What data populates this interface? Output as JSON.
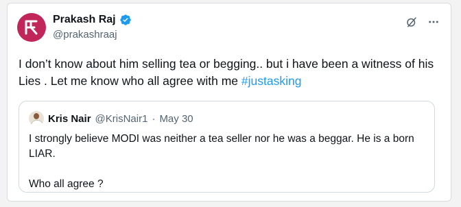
{
  "tweet": {
    "display_name": "Prakash Raj",
    "handle": "@prakashraaj",
    "text_main": "I don’t know about him selling tea or begging.. but i have been a witness of his Lies . Let me know who all agree with me ",
    "hashtag": "#justasking",
    "avatar_icon": "prakash-raj-logo-icon",
    "verified_icon": "verified-badge-icon",
    "grok_icon": "grok-icon",
    "more_icon": "more-options-icon"
  },
  "quote": {
    "display_name": "Kris Nair",
    "handle": "@KrisNair1",
    "separator": "·",
    "date": "May 30",
    "text_line1": "I strongly believe MODI was neither a tea seller nor he was a beggar. He is a born LIAR.",
    "text_line2": "Who all agree ?"
  },
  "colors": {
    "link": "#1d9bf0",
    "verified": "#1d9bf0",
    "avatar_bg": "#c0265a",
    "secondary_text": "#536471"
  }
}
